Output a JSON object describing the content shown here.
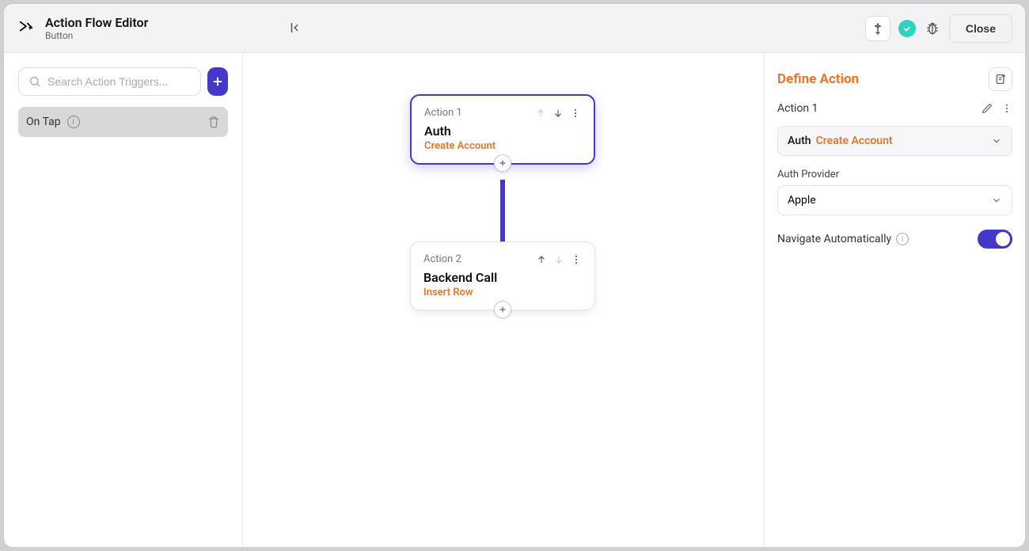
{
  "header": {
    "title": "Action Flow Editor",
    "subtitle": "Button",
    "close_label": "Close"
  },
  "sidebar": {
    "search_placeholder": "Search Action Triggers...",
    "trigger_label": "On Tap"
  },
  "canvas": {
    "node1": {
      "label": "Action 1",
      "title": "Auth",
      "sub": "Create Account"
    },
    "node2": {
      "label": "Action 2",
      "title": "Backend Call",
      "sub": "Insert Row"
    }
  },
  "panel": {
    "title": "Define Action",
    "action_name": "Action 1",
    "action_type_main": "Auth",
    "action_type_sub": "Create Account",
    "provider_label": "Auth Provider",
    "provider_value": "Apple",
    "nav_auto_label": "Navigate Automatically"
  }
}
